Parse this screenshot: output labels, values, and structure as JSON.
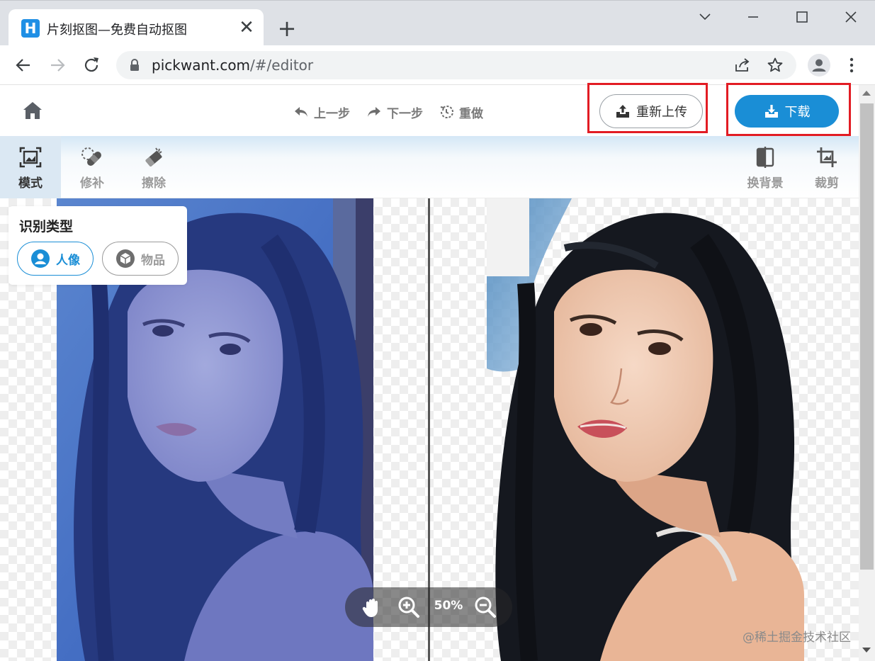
{
  "browser": {
    "tab_title": "片刻抠图—免费自动抠图",
    "tab_logo_letter": "H",
    "url_host": "pickwant.com",
    "url_path": "/#/editor",
    "close_glyph": "✕",
    "new_tab_glyph": "+"
  },
  "header": {
    "undo_label": "上一步",
    "redo_label": "下一步",
    "redo_again_label": "重做",
    "reupload_label": "重新上传",
    "download_label": "下载"
  },
  "tools": {
    "mode": "模式",
    "patch": "修补",
    "erase": "擦除",
    "change_bg": "换背景",
    "crop": "裁剪"
  },
  "recognition": {
    "title": "识别类型",
    "person": "人像",
    "object": "物品",
    "selected": "人像"
  },
  "zoom": {
    "value": "50%"
  },
  "watermark": "@稀土掘金技术社区",
  "colors": {
    "accent": "#1a8ed6",
    "highlight": "#e21c24",
    "mask_overlay": "#3a5fc4"
  }
}
